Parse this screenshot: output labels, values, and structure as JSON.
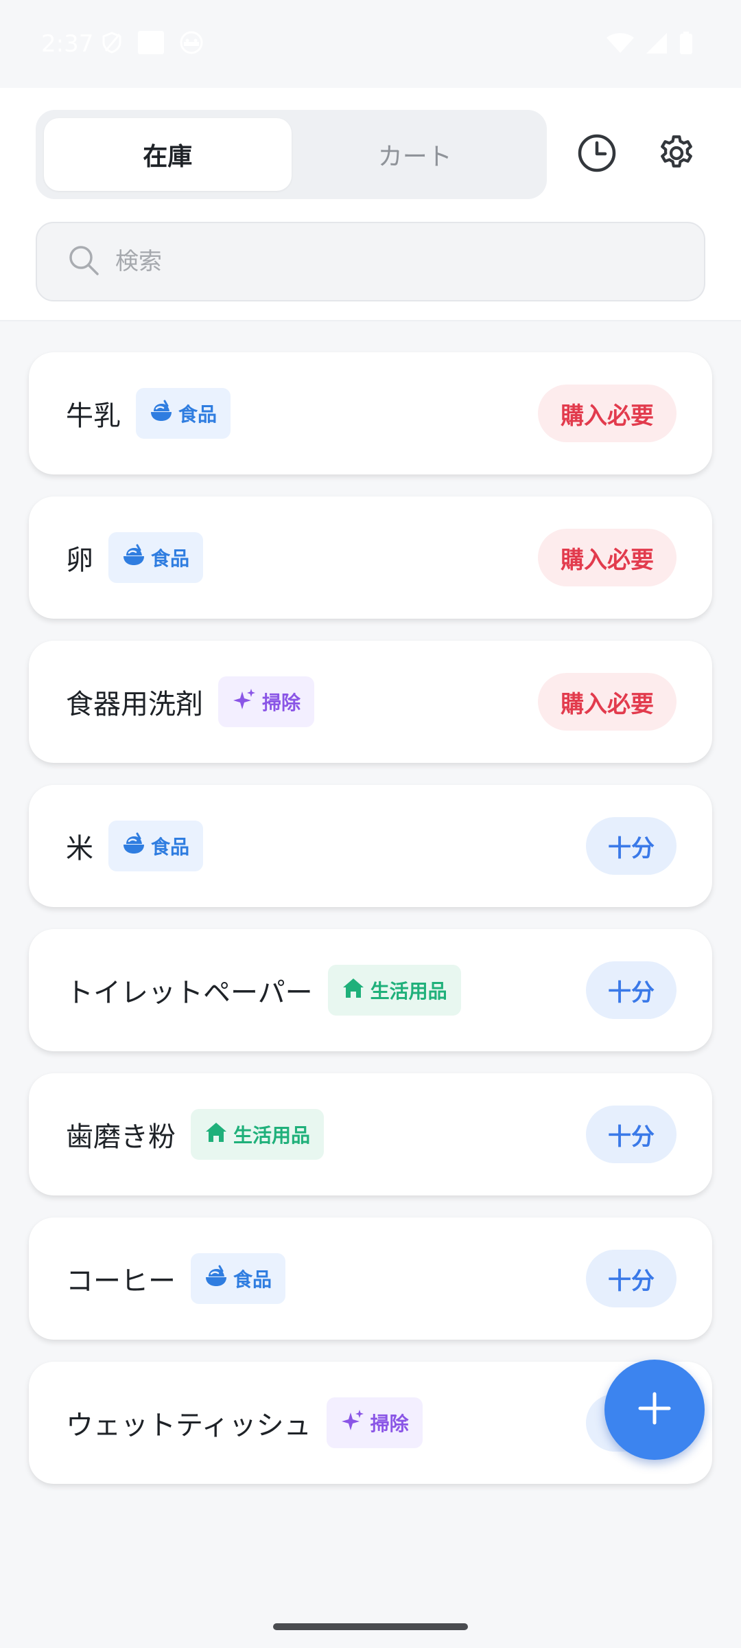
{
  "status_bar": {
    "time": "2:37"
  },
  "header": {
    "tabs": [
      {
        "label": "在庫",
        "active": true
      },
      {
        "label": "カート",
        "active": false
      }
    ],
    "icons": {
      "history": "clock-icon",
      "settings": "gear-icon"
    }
  },
  "search": {
    "placeholder": "検索",
    "value": "",
    "icon": "search-icon"
  },
  "items": [
    {
      "name": "牛乳",
      "category": "食品",
      "category_icon": "food-bowl-icon",
      "status": "購入必要"
    },
    {
      "name": "卵",
      "category": "食品",
      "category_icon": "food-bowl-icon",
      "status": "購入必要"
    },
    {
      "name": "食器用洗剤",
      "category": "掃除",
      "category_icon": "sparkle-icon",
      "status": "購入必要"
    },
    {
      "name": "米",
      "category": "食品",
      "category_icon": "food-bowl-icon",
      "status": "十分"
    },
    {
      "name": "トイレットペーパー",
      "category": "生活用品",
      "category_icon": "house-icon",
      "status": "十分"
    },
    {
      "name": "歯磨き粉",
      "category": "生活用品",
      "category_icon": "house-icon",
      "status": "十分"
    },
    {
      "name": "コーヒー",
      "category": "食品",
      "category_icon": "food-bowl-icon",
      "status": "十分"
    },
    {
      "name": "ウェットティッシュ",
      "category": "掃除",
      "category_icon": "sparkle-icon",
      "status": "十分"
    }
  ],
  "fab": {
    "icon": "plus-icon"
  },
  "colors": {
    "primary": "#3c84ef",
    "need": "#e23b4d",
    "enough": "#3a79e8",
    "food": "#2f7de0",
    "clean": "#8a55e6",
    "living": "#1fb07a"
  }
}
